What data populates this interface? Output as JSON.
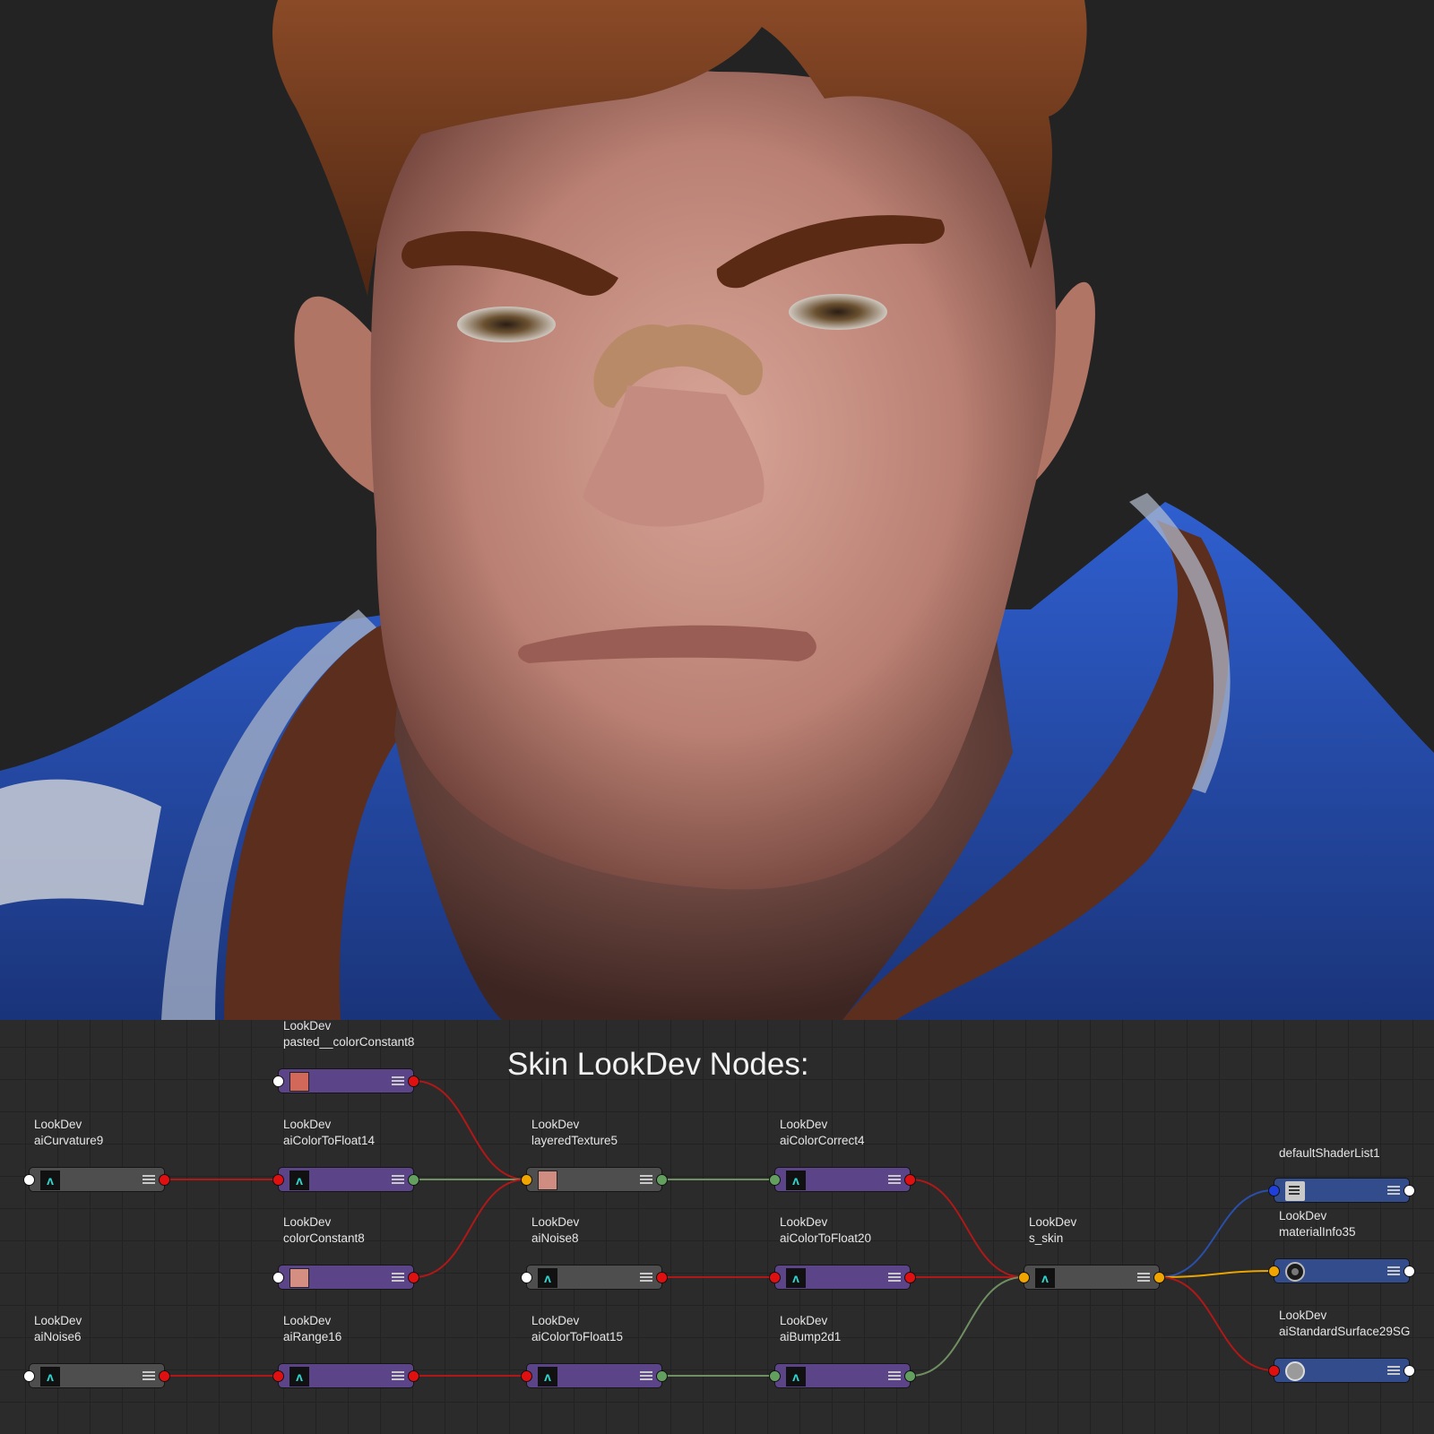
{
  "render": {
    "colors": {
      "background": "#232323",
      "skin": "#cf9a8e",
      "hair": "#6b3418",
      "jacket": "#2a54b8",
      "collar": "#5b2e1e",
      "bandage": "#b98a68"
    }
  },
  "graph": {
    "title": "Skin LookDev Nodes:",
    "wire_colors": {
      "red": "#b01818",
      "green": "#6f8f62",
      "orange": "#e9a400",
      "blue": "#2a4faa"
    },
    "nodes": [
      {
        "id": "pasted_colorConstant8",
        "group": "LookDev",
        "name": "pasted__colorConstant8",
        "color": "purple",
        "icon": "swatch",
        "swatch": "#d2685a",
        "in_port": "white",
        "out_port": "red"
      },
      {
        "id": "aiCurvature9",
        "group": "LookDev",
        "name": "aiCurvature9",
        "color": "gray",
        "icon": "arnold",
        "in_port": "white",
        "out_port": "red"
      },
      {
        "id": "aiColorToFloat14",
        "group": "LookDev",
        "name": "aiColorToFloat14",
        "color": "purple",
        "icon": "arnold",
        "in_port": "red",
        "out_port": "green"
      },
      {
        "id": "layeredTexture5",
        "group": "LookDev",
        "name": "layeredTexture5",
        "color": "gray",
        "icon": "swatch",
        "swatch": "#cf8c80",
        "in_port": "orange",
        "out_port": "green"
      },
      {
        "id": "aiColorCorrect4",
        "group": "LookDev",
        "name": "aiColorCorrect4",
        "color": "purple",
        "icon": "arnold",
        "in_port": "green",
        "out_port": "red"
      },
      {
        "id": "defaultShaderList1",
        "group": "",
        "name": "defaultShaderList1",
        "color": "blue",
        "icon": "list",
        "in_port": "blue",
        "out_port": "white"
      },
      {
        "id": "colorConstant8",
        "group": "LookDev",
        "name": "colorConstant8",
        "color": "purple",
        "icon": "swatch",
        "swatch": "#d48f82",
        "in_port": "white",
        "out_port": "red"
      },
      {
        "id": "aiNoise8",
        "group": "LookDev",
        "name": "aiNoise8",
        "color": "gray",
        "icon": "arnold",
        "in_port": "white",
        "out_port": "red"
      },
      {
        "id": "aiColorToFloat20",
        "group": "LookDev",
        "name": "aiColorToFloat20",
        "color": "purple",
        "icon": "arnold",
        "in_port": "red",
        "out_port": "red"
      },
      {
        "id": "s_skin",
        "group": "LookDev",
        "name": "s_skin",
        "color": "gray",
        "icon": "arnold",
        "in_port": "orange",
        "out_port": "orange"
      },
      {
        "id": "materialInfo35",
        "group": "LookDev",
        "name": "materialInfo35",
        "color": "blue",
        "icon": "material",
        "in_port": "orange",
        "out_port": "white"
      },
      {
        "id": "aiNoise6",
        "group": "LookDev",
        "name": "aiNoise6",
        "color": "gray",
        "icon": "arnold",
        "in_port": "white",
        "out_port": "red"
      },
      {
        "id": "aiRange16",
        "group": "LookDev",
        "name": "aiRange16",
        "color": "purple",
        "icon": "arnold",
        "in_port": "red",
        "out_port": "red"
      },
      {
        "id": "aiColorToFloat15",
        "group": "LookDev",
        "name": "aiColorToFloat15",
        "color": "purple",
        "icon": "arnold",
        "in_port": "red",
        "out_port": "green"
      },
      {
        "id": "aiBump2d1",
        "group": "LookDev",
        "name": "aiBump2d1",
        "color": "purple",
        "icon": "arnold",
        "in_port": "green",
        "out_port": "green"
      },
      {
        "id": "aiStandardSurface29SG",
        "group": "LookDev",
        "name": "aiStandardSurface29SG",
        "color": "blue",
        "icon": "sg",
        "in_port": "red",
        "out_port": "white"
      }
    ],
    "connections": [
      {
        "from": "pasted_colorConstant8",
        "to": "layeredTexture5",
        "color": "red"
      },
      {
        "from": "aiCurvature9",
        "to": "aiColorToFloat14",
        "color": "red"
      },
      {
        "from": "aiColorToFloat14",
        "to": "layeredTexture5",
        "color": "green"
      },
      {
        "from": "colorConstant8",
        "to": "layeredTexture5",
        "color": "red"
      },
      {
        "from": "layeredTexture5",
        "to": "aiColorCorrect4",
        "color": "green"
      },
      {
        "from": "aiColorCorrect4",
        "to": "s_skin",
        "color": "red"
      },
      {
        "from": "aiNoise8",
        "to": "aiColorToFloat20",
        "color": "red"
      },
      {
        "from": "aiColorToFloat20",
        "to": "s_skin",
        "color": "red"
      },
      {
        "from": "aiNoise6",
        "to": "aiRange16",
        "color": "red"
      },
      {
        "from": "aiRange16",
        "to": "aiColorToFloat15",
        "color": "red"
      },
      {
        "from": "aiColorToFloat15",
        "to": "aiBump2d1",
        "color": "green"
      },
      {
        "from": "aiBump2d1",
        "to": "s_skin",
        "color": "green"
      },
      {
        "from": "s_skin",
        "to": "defaultShaderList1",
        "color": "blue"
      },
      {
        "from": "s_skin",
        "to": "materialInfo35",
        "color": "orange"
      },
      {
        "from": "s_skin",
        "to": "aiStandardSurface29SG",
        "color": "red"
      }
    ]
  }
}
